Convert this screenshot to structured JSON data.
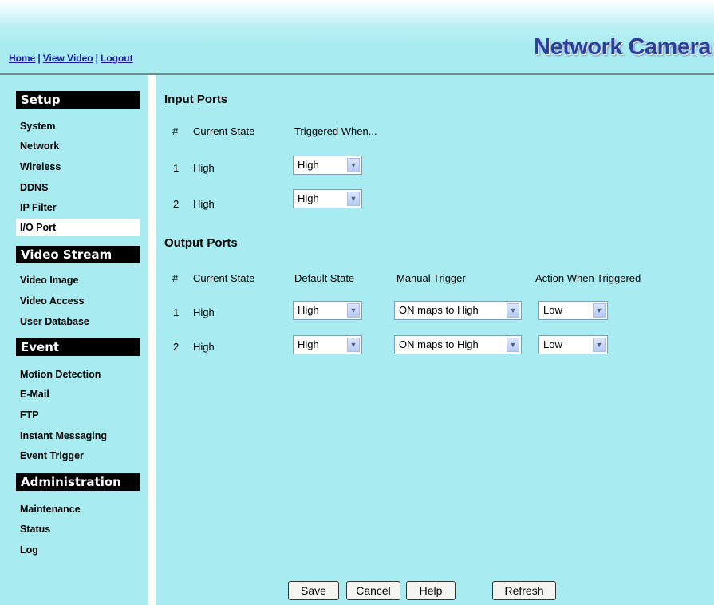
{
  "header": {
    "brand": "Network Camera",
    "nav": [
      {
        "label": "Home"
      },
      {
        "label": "View Video"
      },
      {
        "label": "Logout"
      }
    ],
    "separator": "|"
  },
  "sidebar": {
    "sections": [
      {
        "title": "Setup",
        "items": [
          "System",
          "Network",
          "Wireless",
          "DDNS",
          "IP Filter",
          "I/O Port"
        ]
      },
      {
        "title": "Video Stream",
        "items": [
          "Video Image",
          "Video Access",
          "User Database"
        ]
      },
      {
        "title": "Event",
        "items": [
          "Motion Detection",
          "E-Mail",
          "FTP",
          "Instant Messaging",
          "Event Trigger"
        ]
      },
      {
        "title": "Administration",
        "items": [
          "Maintenance",
          "Status",
          "Log"
        ]
      }
    ],
    "active_item": "I/O Port"
  },
  "input_ports": {
    "title": "Input Ports",
    "headers": {
      "num": "#",
      "current_state": "Current State",
      "triggered_when": "Triggered When..."
    },
    "rows": [
      {
        "num": "1",
        "current_state": "High",
        "triggered_when": "High"
      },
      {
        "num": "2",
        "current_state": "High",
        "triggered_when": "High"
      }
    ]
  },
  "output_ports": {
    "title": "Output Ports",
    "headers": {
      "num": "#",
      "current_state": "Current State",
      "default_state": "Default State",
      "manual_trigger": "Manual Trigger",
      "action": "Action When Triggered"
    },
    "rows": [
      {
        "num": "1",
        "current_state": "High",
        "default_state": "High",
        "manual_trigger": "ON maps to High",
        "action": "Low"
      },
      {
        "num": "2",
        "current_state": "High",
        "default_state": "High",
        "manual_trigger": "ON maps to High",
        "action": "Low"
      }
    ]
  },
  "buttons": {
    "save": "Save",
    "cancel": "Cancel",
    "help": "Help",
    "refresh": "Refresh"
  },
  "icons": {
    "dropdown": "chevron-down-icon"
  },
  "colors": {
    "background": "#a8ebf1",
    "brand": "#2c3f9c",
    "link": "#1a1aa0",
    "section_header": "#000000"
  }
}
